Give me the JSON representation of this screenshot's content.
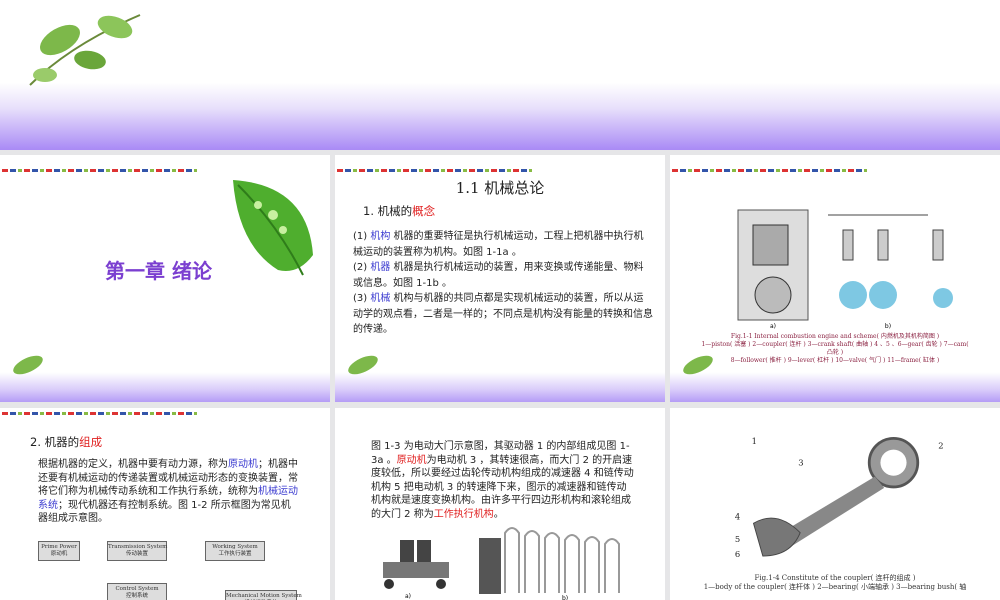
{
  "slides": [
    {
      "title": "第一章  绪论"
    },
    {
      "heading": "1.1    机械总论",
      "subheading_prefix": "1. 机械的",
      "subheading_highlight": "概念",
      "items": [
        {
          "num": "(1)",
          "term": "机构",
          "text": "  机器的重要特征是执行机械运动，工程上把机器中执行机械运动的装置称为机构。如图 1-1a 。"
        },
        {
          "num": "(2)",
          "term": "机器",
          "text": "  机器是执行机械运动的装置，用来变换或传递能量、物料或信息。如图 1-1b 。"
        },
        {
          "num": "(3)",
          "term": "机械",
          "text": "  机构与机器的共同点都是实现机械运动的装置，所以从运动学的观点看，二者是一样的；不同点是机构没有能量的转换和信息的传递。"
        }
      ]
    },
    {
      "caption_lines": [
        "Fig.1-1    Internal combustion engine and scheme( 内燃机及其机构简图 )",
        "1—piston( 活塞 )    2—coupler( 连杆 )    3—crank shaft( 曲轴 )    4 、5 、6—gear( 齿轮 )    7—cam( 凸轮 )",
        "8—follower( 推杆 )    9—lever( 杠杆 )    10—valve( 气门 )    11—frame( 缸体 )"
      ],
      "fig_labels": [
        "a)",
        "b)"
      ]
    },
    {
      "subheading_prefix": "2. 机器的",
      "subheading_highlight": "组成",
      "p1": "    根据机器的定义，机器中要有动力源，称为",
      "t1": "原动机",
      "p2": "；机器中还要有机械运动的传递装置或机械运动形态的变换装置，常将它们称为机械传动系统和工作执行系统，统称为",
      "t2": "机械运动系统",
      "p3": "；现代机器还有控制系统。图 1-2 所示框图为常见机器组成示意图。",
      "diagram": {
        "prime": "Prime Power\n原动机",
        "trans": "Transmission System\n传动装置",
        "work": "Working System\n工作执行装置",
        "ctrl": "Control System\n控制系统",
        "mech": "Mechanical Motion System\n机械运动系统"
      }
    },
    {
      "p1": "    图 1-3 为电动大门示意图，其驱动器 1 的内部组成见图 1-3a 。",
      "t1": "原动机",
      "p2": "为电动机 3 ，其转速很高，而大门 2 的开启速度较低，所以要经过齿轮传动机构组成的减速器 4 和链传动机构 5 把电动机 3 的转速降下来，图示的减速器和链传动机构就是速度变换机构。由许多平行四边形机构和滚轮组成的大门 2 称为",
      "t2": "工作执行机构",
      "p3": "。",
      "fig_labels": [
        "a)",
        "b)"
      ]
    },
    {
      "caption_lines": [
        "Fig.1-4    Constitute of the coupler( 连杆的组成 )",
        "1—body of the coupler( 连杆体 )    2—bearing( 小端轴承 )    3—bearing bush( 轴"
      ],
      "labels": [
        "1",
        "2",
        "3",
        "4",
        "5",
        "6"
      ]
    }
  ],
  "colors": {
    "accent_purple": "#7b3fd0",
    "highlight_red": "#e02020",
    "term_blue": "#3b3bd0"
  }
}
